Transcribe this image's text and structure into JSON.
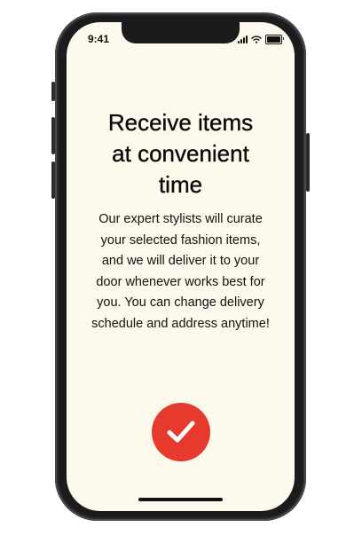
{
  "status_bar": {
    "time": "9:41",
    "icons": [
      "signal-icon",
      "wifi-icon",
      "battery-icon"
    ]
  },
  "onboarding": {
    "title_lines": [
      "Receive items",
      "at convenient",
      "time"
    ],
    "body_lines": [
      "Our expert stylists will curate",
      "your selected fashion items,",
      "and we will deliver it to your",
      "door whenever works best for",
      "you. You can change delivery",
      "schedule and address anytime!"
    ],
    "confirm_icon": "checkmark-icon"
  },
  "colors": {
    "screen_background": "#fdf9ec",
    "accent": "#e63a2f",
    "text": "#111111"
  }
}
